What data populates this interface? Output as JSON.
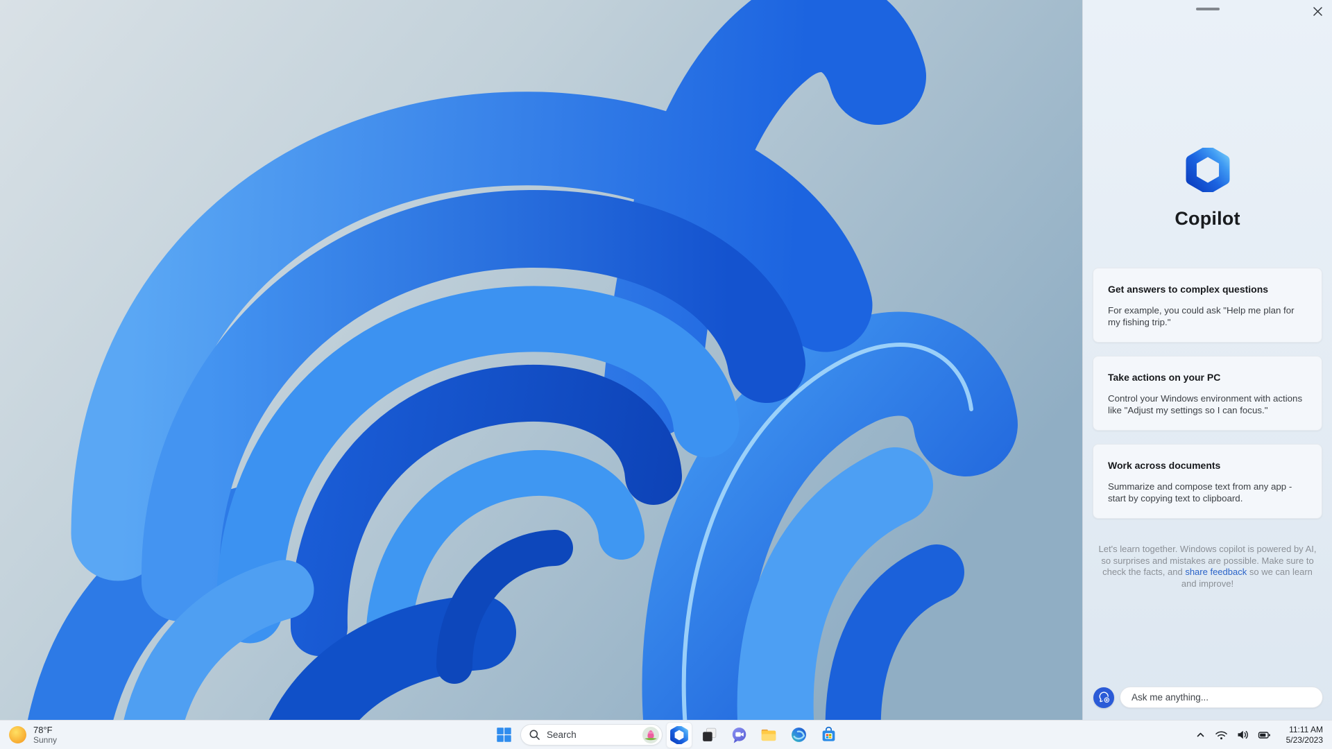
{
  "panel": {
    "title": "Copilot",
    "window_controls": {
      "drag_handle": "panel-drag-handle",
      "close_icon": "close-icon"
    },
    "cards": [
      {
        "title": "Get answers to complex questions",
        "body": "For example, you could ask \"Help me plan for my fishing trip.\""
      },
      {
        "title": "Take actions on your PC",
        "body": "Control your Windows environment with actions like \"Adjust my settings so I can focus.\""
      },
      {
        "title": "Work across documents",
        "body": "Summarize and compose text from any app - start by copying text to clipboard."
      }
    ],
    "disclaimer": {
      "pre": "Let's learn together. Windows copilot is powered by AI, so surprises and mistakes are possible. Make sure to check the facts, and ",
      "link": "share feedback",
      "post": " so we can learn and improve!"
    },
    "input": {
      "placeholder": "Ask me anything..."
    },
    "colors": {
      "accent_blue": "#2b5bd7",
      "link_blue": "#2a63c8",
      "panel_bg": "#e6eef6",
      "card_bg": "#f4f7fb"
    }
  },
  "taskbar": {
    "weather": {
      "temp": "78°F",
      "condition": "Sunny"
    },
    "search": {
      "label": "Search"
    },
    "clock": {
      "time": "11:11 AM",
      "date": "5/23/2023"
    },
    "icons": [
      "sun-icon",
      "start-icon",
      "search-icon",
      "lotus-thumbnail",
      "copilot-icon",
      "task-view-icon",
      "teams-chat-icon",
      "file-explorer-icon",
      "edge-icon",
      "store-icon",
      "chevron-up-icon",
      "wifi-icon",
      "volume-icon",
      "battery-icon"
    ]
  }
}
